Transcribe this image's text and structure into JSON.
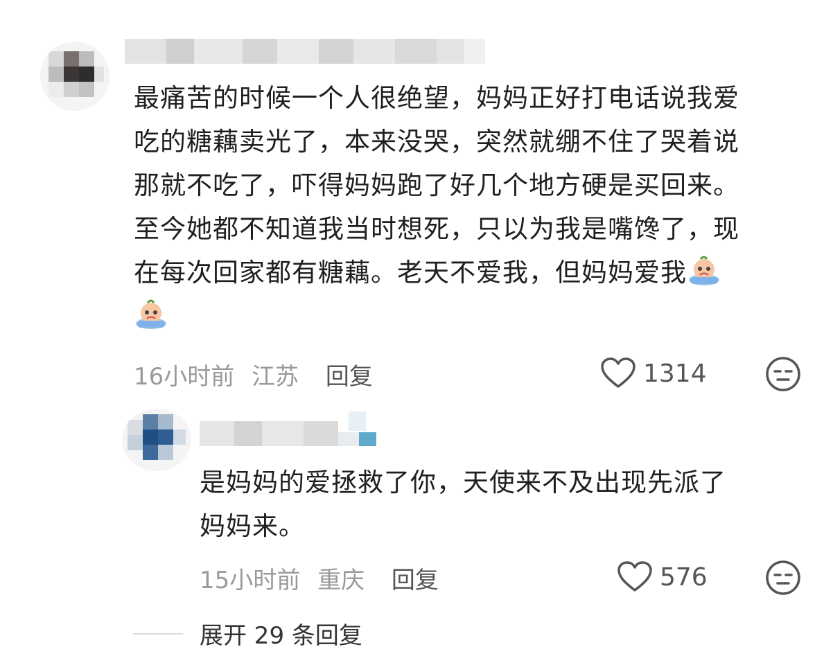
{
  "comment": {
    "username": "",
    "lines": [
      "最痛苦的时候一个人很绝望，妈妈正好打电话说我爱",
      "吃的糖藕卖光了，本来没哭，突然就绷不住了哭着说",
      "那就不吃了，吓得妈妈跑了好几个地方硬是买回来。",
      "至今她都不知道我当时想死，只以为我是嘴馋了，现",
      "在每次回家都有糖藕。老天不爱我，但妈妈爱我"
    ],
    "emoji_name": "crying-emoji",
    "time": "16小时前",
    "region": "江苏",
    "reply_label": "回复",
    "likes": "1314"
  },
  "reply": {
    "username": "",
    "lines": [
      "是妈妈的爱拯救了你，天使来不及出现先派了",
      "妈妈来。"
    ],
    "time": "15小时前",
    "region": "重庆",
    "reply_label": "回复",
    "likes": "576"
  },
  "expand": {
    "label": "展开 29 条回复"
  },
  "colors": {
    "meta": "#9a9a9a",
    "text": "#1f1f1f",
    "icon": "#555555"
  }
}
